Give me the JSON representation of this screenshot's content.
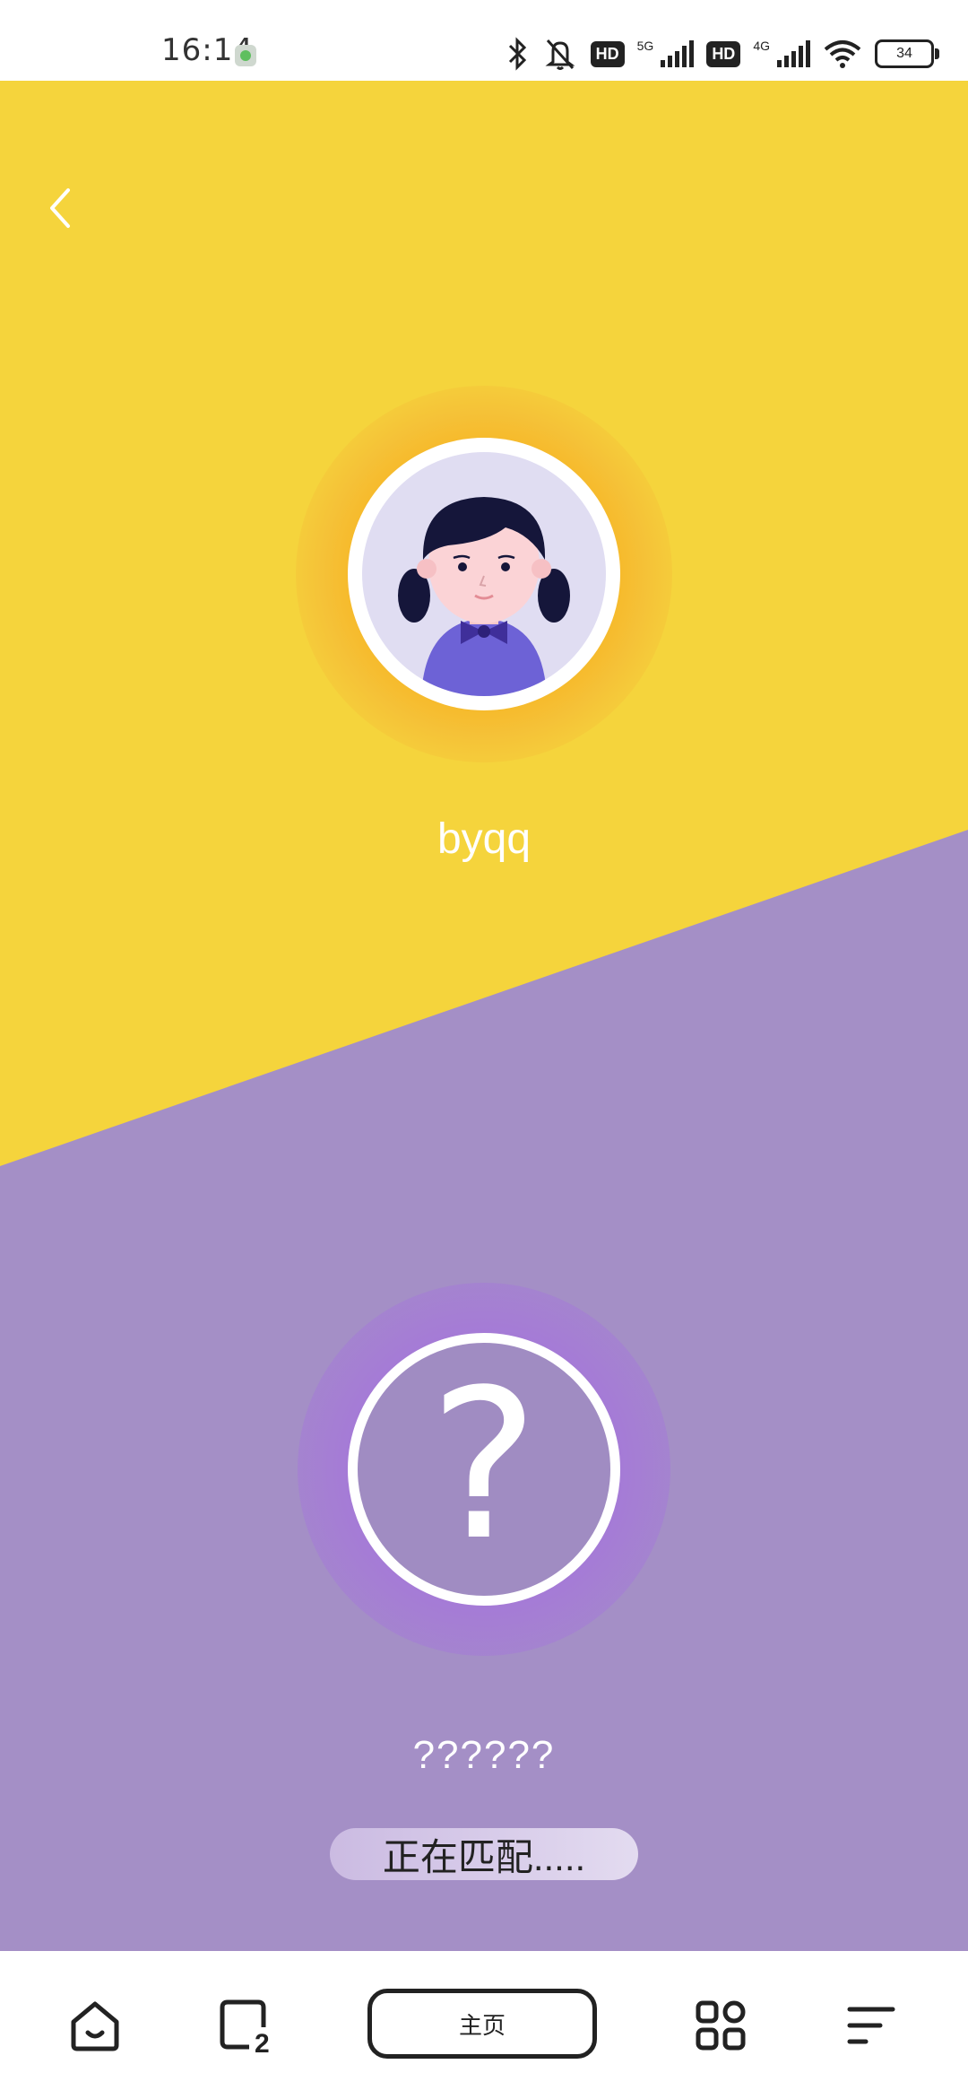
{
  "status_bar": {
    "time": "16:14",
    "network_1": "5G",
    "network_2": "4G",
    "hd_label": "HD",
    "battery": "34"
  },
  "colors": {
    "top_bg": "#f5d43c",
    "bottom_bg": "#a48fc6",
    "avatar_glow": "#f7b625",
    "question_glow": "#a57ad7"
  },
  "user": {
    "name": "byqq",
    "avatar_icon": "girl-avatar-icon"
  },
  "match": {
    "name": "??????",
    "status": "正在匹配....."
  },
  "nav": {
    "home_label": "主页",
    "tabs_count": "2"
  }
}
